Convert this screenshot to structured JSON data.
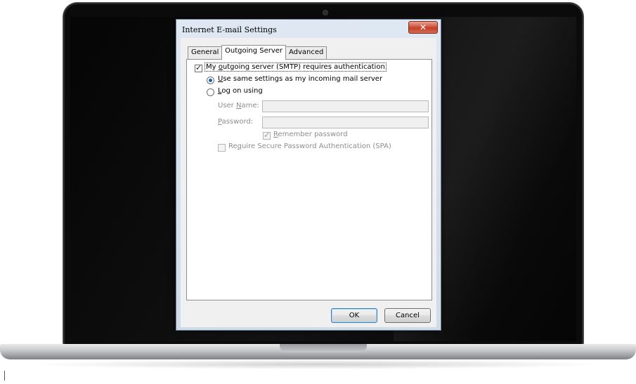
{
  "dialog": {
    "title": "Internet E-mail Settings",
    "close_glyph": "✕"
  },
  "tabs": [
    {
      "label": "General",
      "active": false
    },
    {
      "label": "Outgoing Server",
      "active": true
    },
    {
      "label": "Advanced",
      "active": false
    }
  ],
  "outgoing": {
    "smtp_auth": {
      "pre": "My ",
      "mnemonic": "o",
      "post": "utgoing server (SMTP) requires authentication",
      "checked": true
    },
    "same_settings": {
      "mnemonic": "U",
      "post": "se same settings as my incoming mail server",
      "selected": true
    },
    "log_on_using": {
      "mnemonic": "L",
      "post": "og on using",
      "selected": false
    },
    "username": {
      "pre": "User ",
      "mnemonic": "N",
      "post": "ame:",
      "value": ""
    },
    "password": {
      "mnemonic": "P",
      "post": "assword:",
      "value": ""
    },
    "remember_password": {
      "mnemonic": "R",
      "post": "emember password",
      "checked": true,
      "enabled": false
    },
    "spa": {
      "pre": "Re",
      "mnemonic": "q",
      "post": "uire Secure Password Authentication (SPA)",
      "checked": false,
      "enabled": false
    }
  },
  "buttons": {
    "ok": "OK",
    "cancel": "Cancel"
  }
}
